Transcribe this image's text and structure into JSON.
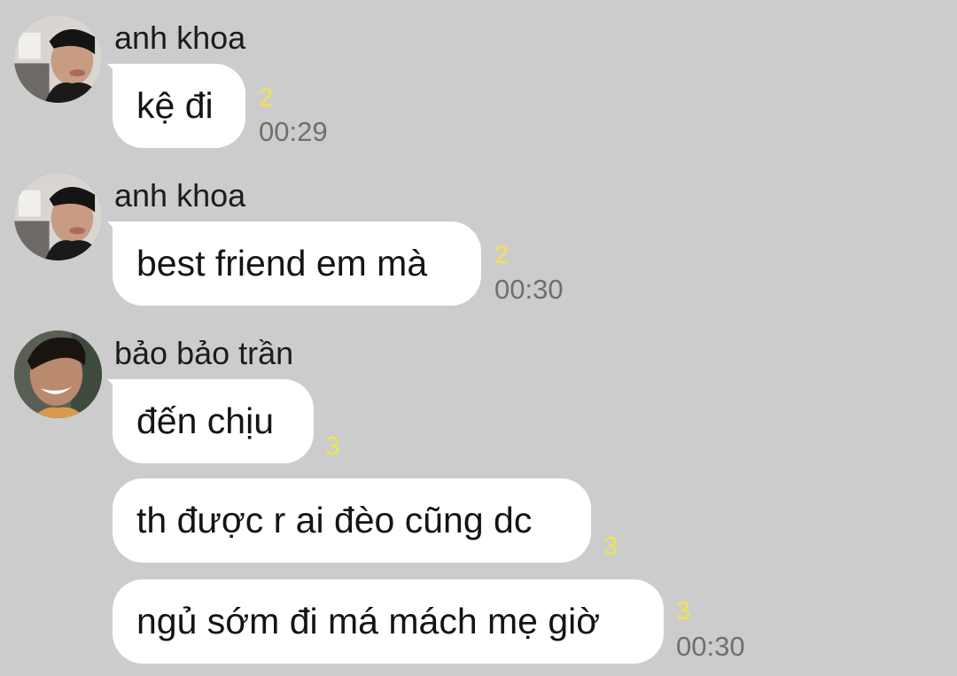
{
  "groups": [
    {
      "sender": "anh khoa",
      "messages": [
        {
          "text": "kệ đi",
          "unread": "2",
          "time": "00:29"
        }
      ]
    },
    {
      "sender": "anh khoa",
      "messages": [
        {
          "text": "best friend em mà",
          "unread": "2",
          "time": "00:30"
        }
      ]
    },
    {
      "sender": "bảo bảo trần",
      "messages": [
        {
          "text": "đến chịu",
          "unread": "3",
          "time": ""
        },
        {
          "text": "th được r ai đèo cũng dc",
          "unread": "3",
          "time": ""
        },
        {
          "text": "ngủ sớm đi má mách mẹ giờ",
          "unread": "3",
          "time": "00:30"
        }
      ]
    }
  ],
  "colors": {
    "background": "#cccccc",
    "bubble": "#ffffff",
    "unread": "#f1e44a",
    "time": "#6f6f6f"
  },
  "icons": {
    "avatar_khoa": "user-photo-avatar",
    "avatar_bao": "user-photo-avatar"
  }
}
